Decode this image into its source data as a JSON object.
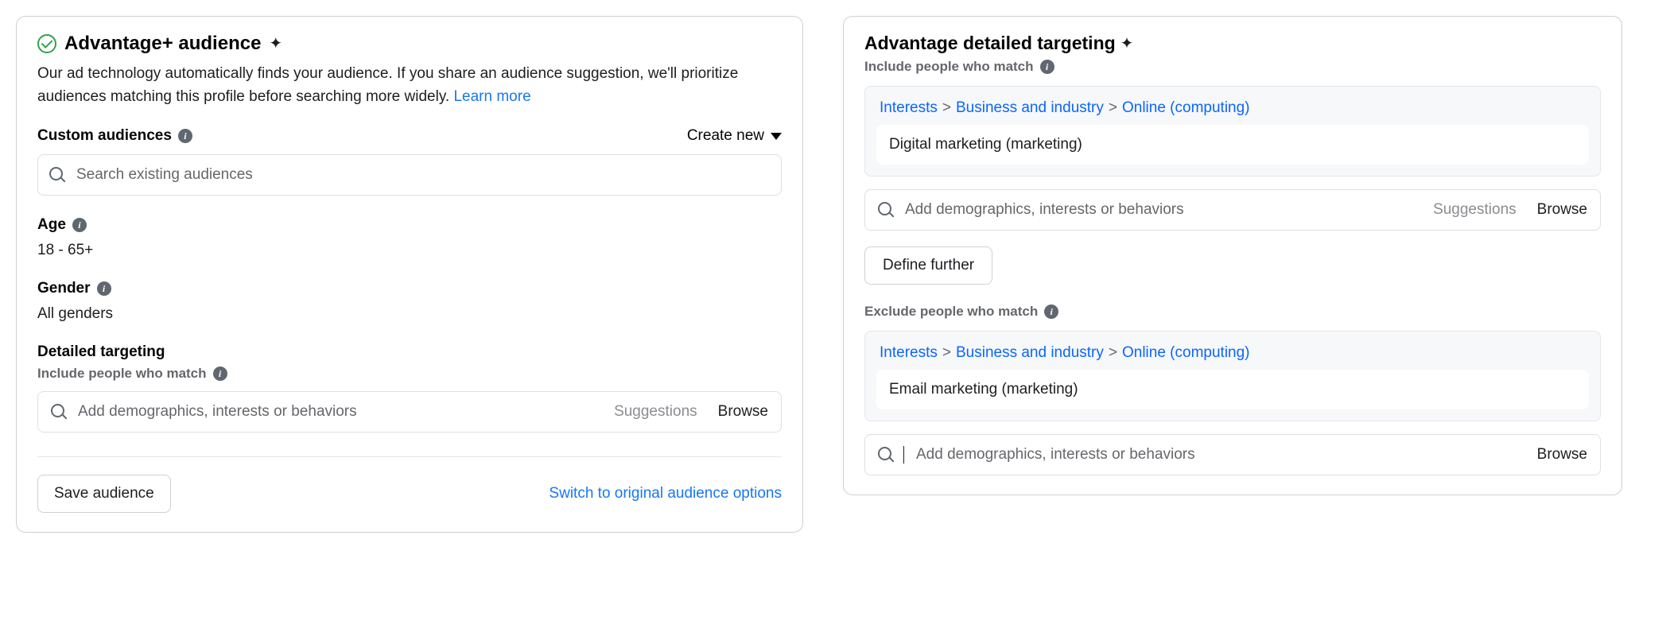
{
  "left": {
    "title": "Advantage+ audience",
    "description_prefix": "Our ad technology automatically finds your audience. If you share an audience suggestion, we'll prioritize audiences matching this profile before searching more widely. ",
    "learn_more": "Learn more",
    "custom_audiences_label": "Custom audiences",
    "create_new": "Create new",
    "search_placeholder": "Search existing audiences",
    "age_label": "Age",
    "age_value": "18 - 65+",
    "gender_label": "Gender",
    "gender_value": "All genders",
    "detailed_targeting_label": "Detailed targeting",
    "include_label": "Include people who match",
    "dt_placeholder": "Add demographics, interests or behaviors",
    "suggestions": "Suggestions",
    "browse": "Browse",
    "save_audience": "Save audience",
    "switch_link": "Switch to original audience options"
  },
  "right": {
    "title": "Advantage detailed targeting",
    "include_label": "Include people who match",
    "include_crumbs": [
      "Interests",
      "Business and industry",
      "Online (computing)"
    ],
    "include_value": "Digital marketing (marketing)",
    "dt_placeholder": "Add demographics, interests or behaviors",
    "suggestions": "Suggestions",
    "browse": "Browse",
    "define_further": "Define further",
    "exclude_label": "Exclude people who match",
    "exclude_crumbs": [
      "Interests",
      "Business and industry",
      "Online (computing)"
    ],
    "exclude_value": "Email marketing (marketing)"
  }
}
